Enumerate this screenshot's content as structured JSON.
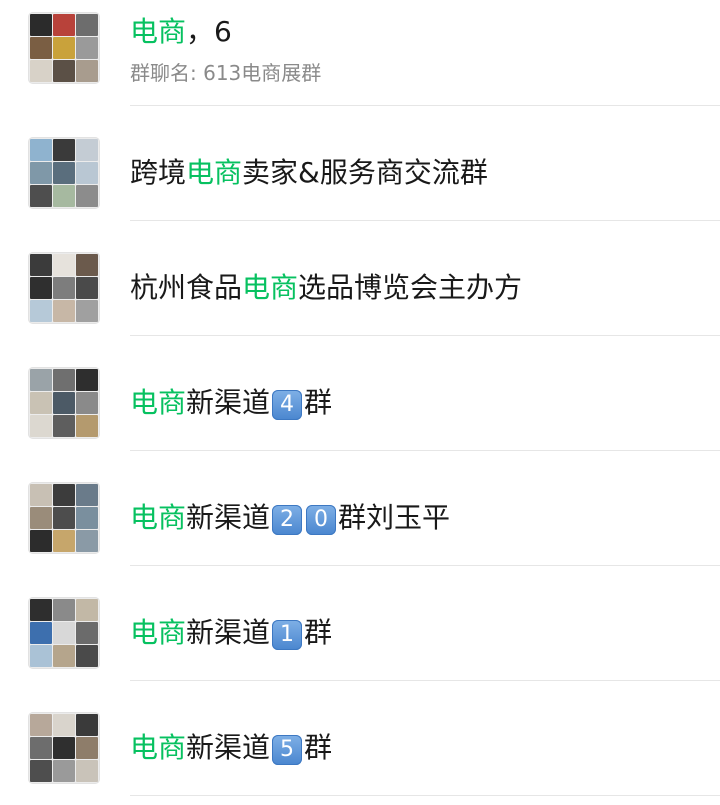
{
  "results": [
    {
      "segments": [
        {
          "text": "电商",
          "hl": true
        },
        {
          "text": "，6",
          "hl": false
        }
      ],
      "subtitle": "群聊名: 613电商展群",
      "avatar_colors": [
        "#2b2b2b",
        "#b8423a",
        "#6d6d6d",
        "#7a5e43",
        "#c9a23b",
        "#9a9a9a",
        "#d8d2c8",
        "#5b5046",
        "#a89c8e"
      ]
    },
    {
      "segments": [
        {
          "text": "跨境",
          "hl": false
        },
        {
          "text": "电商",
          "hl": true
        },
        {
          "text": "卖家&服务商交流群",
          "hl": false
        }
      ],
      "avatar_colors": [
        "#8fb3cf",
        "#3a3a3a",
        "#c4ccd4",
        "#7f98a8",
        "#5a6e7d",
        "#b9c7d3",
        "#4e4e4e",
        "#a6b9a0",
        "#8c8c8c"
      ]
    },
    {
      "segments": [
        {
          "text": "杭州食品",
          "hl": false
        },
        {
          "text": "电商",
          "hl": true
        },
        {
          "text": "选品博览会主办方",
          "hl": false
        }
      ],
      "avatar_colors": [
        "#3b3b3b",
        "#e6e2dc",
        "#6b5a4c",
        "#2f2f2f",
        "#7d7d7d",
        "#4a4a4a",
        "#b6c9d8",
        "#c7b7a6",
        "#a0a0a0"
      ]
    },
    {
      "segments": [
        {
          "text": "电商",
          "hl": true
        },
        {
          "text": "新渠道",
          "hl": false
        },
        {
          "key": "4"
        },
        {
          "text": "群",
          "hl": false
        }
      ],
      "avatar_colors": [
        "#9aa3a8",
        "#6f6f6f",
        "#2e2e2e",
        "#c9c2b4",
        "#4c5a66",
        "#8a8a8a",
        "#dcd8d0",
        "#5e5e5e",
        "#b49a6e"
      ]
    },
    {
      "segments": [
        {
          "text": "电商",
          "hl": true
        },
        {
          "text": "新渠道",
          "hl": false
        },
        {
          "key": "2"
        },
        {
          "key": "0"
        },
        {
          "text": "群刘玉平",
          "hl": false
        }
      ],
      "avatar_colors": [
        "#c8c0b4",
        "#3c3c3c",
        "#6a7b8a",
        "#9a8c7a",
        "#4d4d4d",
        "#7a8f9e",
        "#2c2c2c",
        "#c6a66b",
        "#8a9aa6"
      ]
    },
    {
      "segments": [
        {
          "text": "电商",
          "hl": true
        },
        {
          "text": "新渠道",
          "hl": false
        },
        {
          "key": "1"
        },
        {
          "text": "群",
          "hl": false
        }
      ],
      "avatar_colors": [
        "#2e2e2e",
        "#8a8a8a",
        "#c2b8a6",
        "#3d6fae",
        "#d8d8d8",
        "#6b6b6b",
        "#aac2d6",
        "#b5a58c",
        "#4a4a4a"
      ]
    },
    {
      "segments": [
        {
          "text": "电商",
          "hl": true
        },
        {
          "text": "新渠道",
          "hl": false
        },
        {
          "key": "5"
        },
        {
          "text": "群",
          "hl": false
        }
      ],
      "avatar_colors": [
        "#b7a89a",
        "#d9d4cc",
        "#3a3a3a",
        "#6d6d6d",
        "#2f2f2f",
        "#8e7d6a",
        "#4e4e4e",
        "#9a9a9a",
        "#c9c3b9"
      ]
    }
  ]
}
